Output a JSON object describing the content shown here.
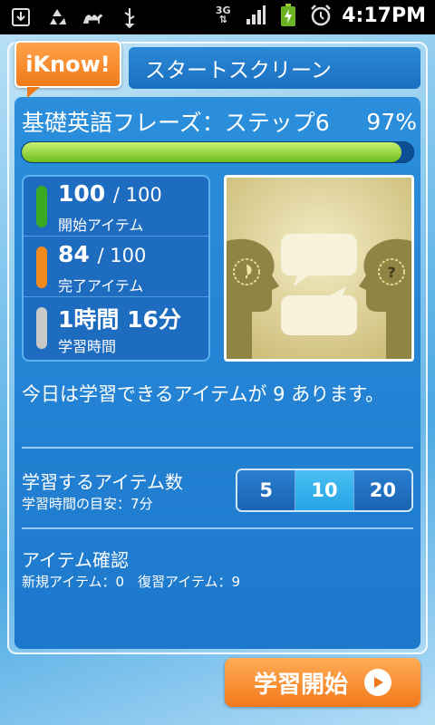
{
  "status_bar": {
    "time": "4:17PM",
    "network": "3G",
    "icons": [
      "download-icon",
      "recycle-icon",
      "camel-icon",
      "usb-icon",
      "signal-icon",
      "battery-charging-icon",
      "alarm-icon"
    ]
  },
  "logo": {
    "text": "iKnow!"
  },
  "screen": {
    "title": "スタートスクリーン"
  },
  "course": {
    "title": "基礎英語フレーズ：ステップ6",
    "percent_label": "97%",
    "progress": 0.97
  },
  "stats": [
    {
      "value": "100",
      "total": "/ 100",
      "label": "開始アイテム",
      "color": "#3aa820"
    },
    {
      "value": "84",
      "total": "/ 100",
      "label": "完了アイテム",
      "color": "#f08a1e"
    },
    {
      "value": "1時間 16分",
      "total": "",
      "label": "学習時間",
      "color": "#c9c9c9"
    }
  ],
  "today_message": "今日は学習できるアイテムが 9 あります。",
  "study_count": {
    "label": "学習するアイテム数",
    "estimate": "学習時間の目安：7分",
    "options": [
      "5",
      "10",
      "20"
    ],
    "selected": "10"
  },
  "item_check": {
    "label": "アイテム確認",
    "detail": "新規アイテム：0　復習アイテム：9"
  },
  "start_button": {
    "label": "学習開始"
  },
  "colors": {
    "accent_orange": "#f07a1a",
    "panel_blue": "#1d78cc"
  }
}
